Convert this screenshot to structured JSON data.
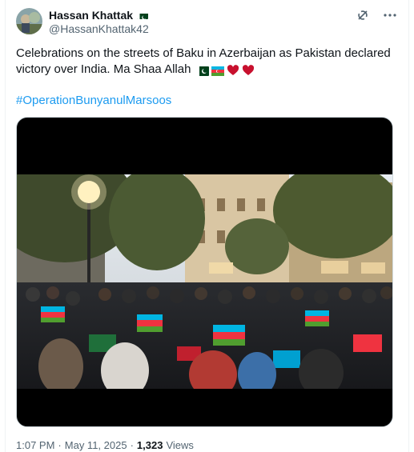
{
  "author": {
    "name": "Hassan Khattak",
    "handle": "@HassanKhattak42",
    "flag_icon": "pakistan-flag-icon"
  },
  "actions": {
    "grok_icon": "grok-icon",
    "more_icon": "more-icon"
  },
  "tweet": {
    "text": "Celebrations on the streets of Baku in Azerbaijan as Pakistan declared victory over India. Ma Shaa Allah",
    "emojis": [
      "pakistan-flag-icon",
      "azerbaijan-flag-icon",
      "heart-icon",
      "heart-icon"
    ],
    "hashtag": "#OperationBunyanulMarsoos"
  },
  "media": {
    "type": "video",
    "description_icon": "crowd-video"
  },
  "meta": {
    "time": "1:07 PM",
    "date": "May 11, 2025",
    "separator": "·",
    "views_count": "1,323",
    "views_label": "Views"
  },
  "colors": {
    "accent": "#1d9bf0",
    "text": "#0f1419",
    "secondary": "#536471",
    "heart": "#c8102e"
  }
}
